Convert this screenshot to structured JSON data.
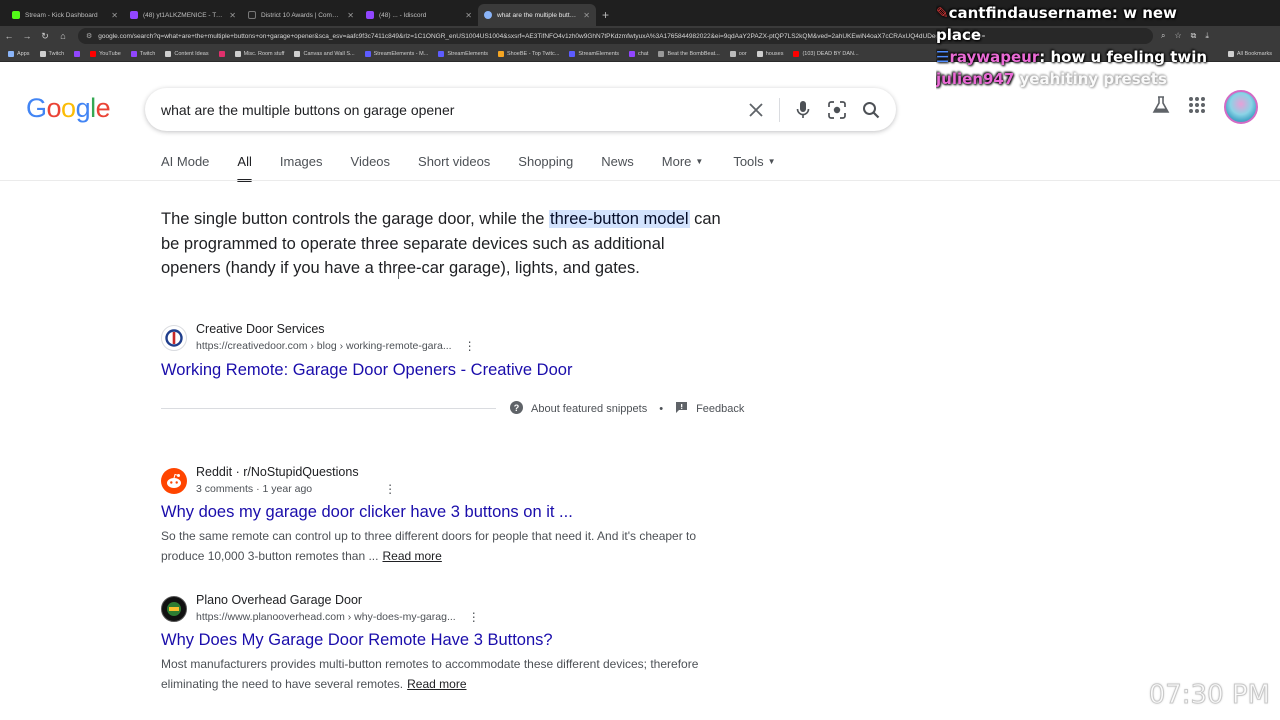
{
  "browser": {
    "tabs": [
      {
        "title": "Stream - Kick Dashboard",
        "color": "#53fc18",
        "active": false
      },
      {
        "title": "(48) yt1ALKZMENICE - Twitch",
        "color": "#9146ff",
        "active": false
      },
      {
        "title": "District 10 Awards | Communit...",
        "color": "#222222",
        "active": false
      },
      {
        "title": "(48) ... - Idiscord",
        "color": "#9146ff",
        "active": false
      },
      {
        "title": "what are the multiple buttons o...",
        "color": "#8ab4f8",
        "active": true
      }
    ],
    "url": "google.com/search?q=what+are+the+multiple+buttons+on+garage+opener&sca_esv=aafc9f3c7411c849&rlz=1C1ONGR_enUS1004US1004&sxsrf=AE3TifNFO4v1zh0w9GhN7tPKdzmfwtyuxA%3A1765844982022&ei=9qdAaY2PAZX-ptQP7LS2kQM&ved=2ahUKEwiN4oaX7cCRAxUQ4dUDegQIBRAM&uact=",
    "bookmarks": [
      "Apps",
      "Twitch",
      "",
      "YouTube",
      "Twitch",
      "Content Ideas",
      "",
      "Misc. Room stuff",
      "Canvas and Wall S...",
      "StreamElements - M...",
      "StreamElements",
      "ShoeBE - Top Twitc...",
      "StreamElements",
      "chat",
      "Beat the BombBeat...",
      "oor",
      "houses",
      "(103) DEAD BY DAN..."
    ],
    "bookmarks_right": "All Bookmarks"
  },
  "google": {
    "logo_letters": [
      "G",
      "o",
      "o",
      "g",
      "l",
      "e"
    ],
    "logo_colors": [
      "#4285f4",
      "#ea4335",
      "#fbbc05",
      "#4285f4",
      "#34a853",
      "#ea4335"
    ],
    "query": "what are the multiple buttons on garage opener",
    "tabs": [
      {
        "label": "AI Mode",
        "active": false
      },
      {
        "label": "All",
        "active": true
      },
      {
        "label": "Images",
        "active": false
      },
      {
        "label": "Videos",
        "active": false
      },
      {
        "label": "Short videos",
        "active": false
      },
      {
        "label": "Shopping",
        "active": false
      },
      {
        "label": "News",
        "active": false
      },
      {
        "label": "More",
        "active": false
      }
    ],
    "tools_label": "Tools"
  },
  "featured": {
    "text_before": "The single button controls the garage door, while the ",
    "highlight": "three-button model",
    "text_after": " can be programmed to operate three separate devices such as additional openers (handy if you have a three-car garage), lights, and gates.",
    "source_name": "Creative Door Services",
    "source_url": "https://creativedoor.com › blog › working-remote-gara...",
    "link_title": "Working Remote: Garage Door Openers - Creative Door",
    "about": "About featured snippets",
    "feedback": "Feedback"
  },
  "results": [
    {
      "source_name": "Reddit · r/NoStupidQuestions",
      "meta": "3 comments · 1 year ago",
      "title": "Why does my garage door clicker have 3 buttons on it ...",
      "desc": "So the same remote can control up to three different doors for people that need it. And it's cheaper to produce 10,000 3-button remotes than ...",
      "read_more": "Read more"
    },
    {
      "source_name": "Plano Overhead Garage Door",
      "meta": "https://www.planooverhead.com › why-does-my-garag...",
      "title": "Why Does My Garage Door Remote Have 3 Buttons?",
      "desc": "Most manufacturers provides multi-button remotes to accommodate these different devices; therefore eliminating the need to have several remotes.",
      "read_more": "Read more"
    }
  ],
  "overlay": {
    "line1_user": "cantfindausername",
    "line1_msg": ": w new",
    "line2": "place",
    "line2_user": "raywapeur",
    "line2_msg": ": how u feeling twin",
    "line3_user": "julien947",
    "line3_msg": "yeahitiny presets",
    "clock": "07:30 PM"
  }
}
